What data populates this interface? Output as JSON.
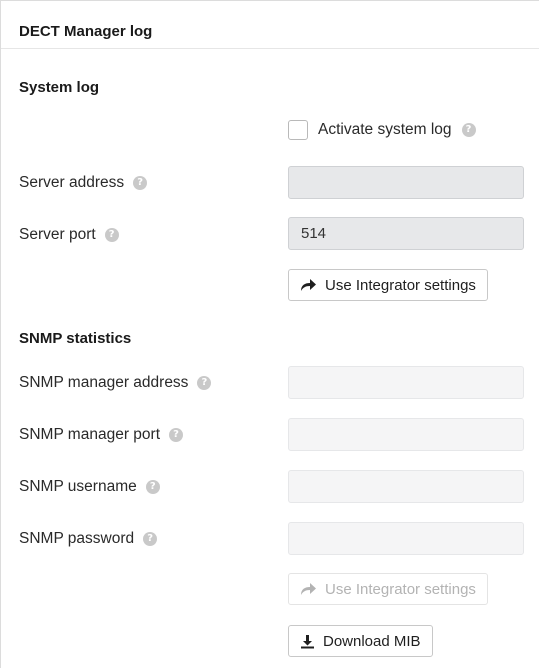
{
  "panel": {
    "title": "DECT Manager log"
  },
  "system_log": {
    "section_title": "System log",
    "activate_label": "Activate system log",
    "activate_checked": false,
    "server_address": {
      "label": "Server address",
      "value": ""
    },
    "server_port": {
      "label": "Server port",
      "value": "514"
    },
    "integrator_button_label": "Use Integrator settings"
  },
  "snmp": {
    "section_title": "SNMP statistics",
    "manager_address": {
      "label": "SNMP manager address",
      "value": ""
    },
    "manager_port": {
      "label": "SNMP manager port",
      "value": ""
    },
    "username": {
      "label": "SNMP username",
      "value": ""
    },
    "password": {
      "label": "SNMP password",
      "value": ""
    },
    "integrator_button_label": "Use Integrator settings",
    "download_button_label": "Download MIB"
  },
  "icons": {
    "help": "help-icon",
    "share": "share-arrow-icon",
    "download": "download-icon"
  }
}
